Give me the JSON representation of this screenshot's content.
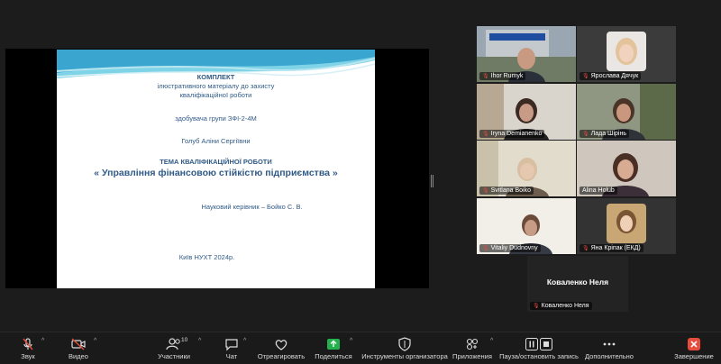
{
  "slide": {
    "title": "КОМПЛЕКТ",
    "line1": "ілюстративного матеріалу до захисту",
    "line2": "кваліфікаційної роботи",
    "student_group": "здобувача групи ЗФІ-2-4М",
    "student_name": "Голуб Аліни Сергіївни",
    "topic_label": "ТЕМА КВАЛІФІКАЦІЙНОЇ РОБОТИ",
    "topic": "« Управління фінансовою стійкістю підприємства »",
    "supervisor": "Науковий керівник – Бойко С. В.",
    "footer": "Київ НУХТ 2024р."
  },
  "participants": [
    {
      "name": "Ihor Rumyk"
    },
    {
      "name": "Ярослава Дячук"
    },
    {
      "name": "Iryna Demianenko"
    },
    {
      "name": "Лада Шірінь"
    },
    {
      "name": "Svitlana Boiko"
    },
    {
      "name": "Alina Holub"
    },
    {
      "name": "Vitaliy Dudnovny"
    },
    {
      "name": "Яна Кріпак (ЕКД)"
    }
  ],
  "name_tile": {
    "center_name": "Коваленко Неля",
    "label": "Коваленко Неля"
  },
  "toolbar": {
    "audio": "Звук",
    "video": "Видео",
    "participants": "Участники",
    "participants_count": "10",
    "chat": "Чат",
    "react": "Отреагировать",
    "share": "Поделиться",
    "host_tools": "Инструменты организатора",
    "apps": "Приложения",
    "record": "Пауза/остановить запись",
    "more": "Дополнительно",
    "end": "Завершение"
  },
  "colors": {
    "active_speaker": "#2ecc71",
    "share_green": "#22b14c",
    "end_red": "#e74c3c",
    "slide_text": "#2f5a87"
  }
}
